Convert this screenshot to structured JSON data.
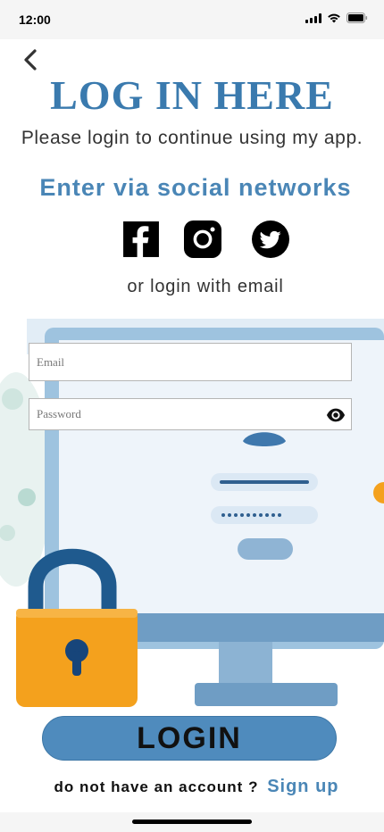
{
  "status_bar": {
    "time": "12:00"
  },
  "header": {
    "title": "LOG IN HERE",
    "subtitle": "Please login to continue using my app."
  },
  "social": {
    "heading": "Enter via social networks",
    "networks": [
      "facebook-icon",
      "instagram-icon",
      "twitter-icon"
    ],
    "email_hint": "or login with email"
  },
  "form": {
    "email_placeholder": "Email",
    "password_placeholder": "Password",
    "login_label": "LOGIN"
  },
  "signup": {
    "prompt": "do not have an account ?",
    "link_label": "Sign up"
  },
  "colors": {
    "title": "#3a7aae",
    "accent": "#4a86b6",
    "button": "#4f8bbd",
    "lock": "#f4a11d"
  }
}
